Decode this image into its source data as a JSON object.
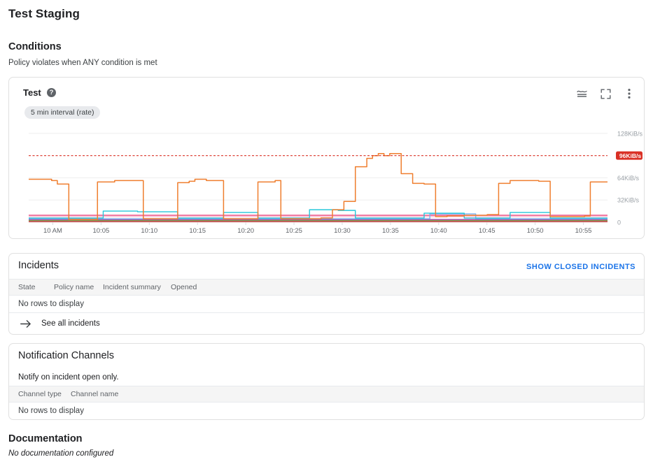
{
  "page": {
    "title": "Test Staging"
  },
  "conditions": {
    "heading": "Conditions",
    "subtitle": "Policy violates when ANY condition is met",
    "chart_card": {
      "title": "Test",
      "help_icon": "help-icon",
      "help_glyph": "?",
      "interval_chip": "5 min interval (rate)",
      "actions": [
        {
          "name": "chart-legend-icon",
          "label": "Legend"
        },
        {
          "name": "fullscreen-icon",
          "label": "Expand"
        },
        {
          "name": "more-options-icon",
          "label": "More options"
        }
      ]
    }
  },
  "incidents": {
    "heading": "Incidents",
    "show_closed_label": "SHOW CLOSED INCIDENTS",
    "columns": [
      "State",
      "Policy name",
      "Incident summary",
      "Opened"
    ],
    "empty_text": "No rows to display",
    "see_all_label": "See all incidents",
    "see_all_icon": "arrow-right-icon"
  },
  "notification_channels": {
    "heading": "Notification Channels",
    "notify_text": "Notify on incident open only.",
    "columns": [
      "Channel type",
      "Channel name"
    ],
    "empty_text": "No rows to display"
  },
  "documentation": {
    "heading": "Documentation",
    "body": "No documentation configured"
  },
  "colors": {
    "accent_link": "#1a73e8",
    "threshold": "#d93025",
    "primary_series": "#ef7e2e",
    "chip_bg": "#e8eaed",
    "grid": "#eeeeee"
  },
  "chart_data": {
    "type": "line",
    "title": "Test",
    "xlabel": "",
    "ylabel": "",
    "grid": true,
    "legend_position": "none",
    "ylim": [
      0,
      140
    ],
    "y_ticks": [
      0,
      32,
      64,
      128
    ],
    "y_tick_labels": [
      "0",
      "32KiB/s",
      "64KiB/s",
      "128KiB/s"
    ],
    "y_unit": "KiB/s",
    "x_tick_labels": [
      "10 AM",
      "10:05",
      "10:10",
      "10:15",
      "10:20",
      "10:25",
      "10:30",
      "10:35",
      "10:40",
      "10:45",
      "10:50",
      "10:55"
    ],
    "threshold": {
      "value": 96,
      "label": "96KiB/s",
      "style": "dashed",
      "color": "#d93025"
    },
    "series": [
      {
        "name": "series-primary",
        "color": "#ef7e2e",
        "values": [
          62,
          62,
          62,
          62,
          60,
          55,
          55,
          4,
          4,
          4,
          4,
          4,
          58,
          58,
          58,
          60,
          60,
          60,
          60,
          60,
          5,
          5,
          5,
          5,
          5,
          5,
          57,
          57,
          59,
          62,
          62,
          60,
          60,
          60,
          5,
          5,
          5,
          5,
          5,
          5,
          58,
          58,
          58,
          60,
          5,
          5,
          5,
          5,
          5,
          5,
          5,
          6,
          6,
          18,
          18,
          30,
          30,
          80,
          80,
          92,
          96,
          99,
          96,
          99,
          99,
          70,
          70,
          56,
          56,
          55,
          55,
          8,
          8,
          9,
          9,
          9,
          10,
          10,
          10,
          10,
          11,
          11,
          56,
          56,
          60,
          60,
          60,
          60,
          60,
          59,
          59,
          8,
          8,
          8,
          8,
          8,
          8,
          9,
          58,
          58,
          58,
          58
        ]
      },
      {
        "name": "series-cyan",
        "color": "#26c6da",
        "values": [
          6,
          6,
          6,
          6,
          6,
          6,
          6,
          6,
          6,
          6,
          6,
          6,
          6,
          16,
          16,
          16,
          16,
          16,
          16,
          15,
          15,
          15,
          15,
          15,
          15,
          15,
          6,
          6,
          6,
          6,
          6,
          6,
          6,
          6,
          14,
          14,
          14,
          14,
          14,
          14,
          6,
          6,
          6,
          6,
          6,
          6,
          6,
          6,
          6,
          18,
          18,
          18,
          18,
          18,
          17,
          17,
          17,
          6,
          6,
          6,
          6,
          6,
          6,
          6,
          6,
          6,
          6,
          6,
          6,
          13,
          13,
          13,
          13,
          13,
          13,
          13,
          6,
          6,
          6,
          6,
          6,
          6,
          6,
          6,
          14,
          14,
          14,
          14,
          14,
          14,
          14,
          6,
          6,
          6,
          6,
          6,
          6,
          6,
          6,
          6,
          6,
          6
        ]
      },
      {
        "name": "series-lightblue",
        "color": "#77b2ef",
        "values": [
          5,
          5,
          5,
          5,
          5,
          5,
          5,
          5,
          5,
          5,
          5,
          5,
          5,
          5,
          5,
          5,
          5,
          5,
          5,
          5,
          5,
          5,
          5,
          5,
          5,
          5,
          5,
          5,
          5,
          5,
          5,
          5,
          5,
          5,
          5,
          5,
          5,
          5,
          5,
          5,
          5,
          5,
          5,
          5,
          5,
          5,
          5,
          5,
          5,
          5,
          5,
          5,
          5,
          5,
          5,
          5,
          5,
          5,
          5,
          5,
          5,
          5,
          5,
          5,
          5,
          5,
          5,
          5,
          5,
          5,
          12,
          12,
          12,
          12,
          12,
          12,
          12,
          12,
          5,
          5,
          5,
          5,
          5,
          5,
          5,
          5,
          5,
          5,
          5,
          5,
          5,
          5,
          5,
          5,
          5,
          5,
          5,
          5,
          5,
          5,
          5,
          5
        ]
      },
      {
        "name": "series-pink",
        "color": "#ec407a",
        "values": [
          10,
          10,
          10,
          10,
          10,
          10,
          10,
          10,
          10,
          10,
          10,
          10,
          10,
          10,
          10,
          10,
          10,
          10,
          10,
          10,
          10,
          10,
          10,
          10,
          10,
          10,
          10,
          10,
          10,
          10,
          10,
          10,
          10,
          10,
          10,
          10,
          10,
          10,
          10,
          10,
          10,
          10,
          10,
          10,
          10,
          10,
          10,
          10,
          10,
          10,
          10,
          10,
          10,
          10,
          10,
          10,
          10,
          10,
          10,
          10,
          10,
          10,
          10,
          10,
          10,
          10,
          10,
          10,
          10,
          10,
          10,
          10,
          10,
          10,
          10,
          10,
          10,
          10,
          10,
          10,
          10,
          10,
          10,
          10,
          10,
          10,
          10,
          10,
          10,
          10,
          10,
          10,
          10,
          10,
          10,
          10,
          10,
          10,
          10,
          10,
          10,
          10
        ]
      },
      {
        "name": "series-lightpink",
        "color": "#f8bbd0",
        "values": [
          8,
          8,
          8,
          8,
          8,
          8,
          8,
          8,
          8,
          8,
          8,
          8,
          8,
          8,
          8,
          8,
          8,
          8,
          8,
          8,
          8,
          8,
          8,
          8,
          8,
          8,
          8,
          8,
          8,
          8,
          8,
          8,
          8,
          8,
          8,
          8,
          8,
          8,
          8,
          8,
          8,
          8,
          8,
          8,
          8,
          8,
          8,
          8,
          8,
          8,
          8,
          8,
          8,
          8,
          8,
          8,
          8,
          8,
          8,
          8,
          8,
          8,
          8,
          8,
          8,
          8,
          8,
          8,
          8,
          8,
          8,
          8,
          8,
          8,
          8,
          8,
          8,
          8,
          8,
          8,
          8,
          8,
          8,
          8,
          8,
          8,
          8,
          8,
          8,
          8,
          8,
          8,
          8,
          8,
          8,
          8,
          8,
          8,
          8,
          8,
          8,
          8
        ]
      },
      {
        "name": "series-purple",
        "color": "#ab47bc",
        "values": [
          4,
          4,
          4,
          4,
          4,
          4,
          4,
          4,
          4,
          4,
          4,
          4,
          4,
          4,
          4,
          4,
          4,
          4,
          4,
          4,
          4,
          4,
          4,
          4,
          4,
          4,
          4,
          4,
          4,
          4,
          4,
          4,
          4,
          4,
          4,
          4,
          4,
          4,
          4,
          4,
          4,
          4,
          4,
          4,
          4,
          4,
          4,
          4,
          4,
          4,
          4,
          4,
          4,
          4,
          4,
          4,
          4,
          4,
          4,
          4,
          4,
          4,
          4,
          4,
          4,
          4,
          4,
          4,
          4,
          4,
          4,
          4,
          4,
          4,
          4,
          4,
          4,
          4,
          4,
          4,
          4,
          4,
          4,
          4,
          4,
          4,
          4,
          4,
          4,
          4,
          4,
          4,
          4,
          4,
          4,
          4,
          4,
          4,
          4,
          4,
          4,
          4
        ]
      },
      {
        "name": "series-green",
        "color": "#7cb342",
        "values": [
          3,
          3,
          3,
          3,
          3,
          3,
          3,
          3,
          3,
          3,
          3,
          3,
          3,
          3,
          3,
          3,
          3,
          3,
          3,
          3,
          3,
          3,
          3,
          3,
          3,
          3,
          3,
          3,
          3,
          3,
          3,
          3,
          3,
          3,
          3,
          3,
          3,
          3,
          3,
          3,
          3,
          3,
          3,
          3,
          3,
          3,
          3,
          3,
          3,
          3,
          3,
          3,
          3,
          3,
          3,
          3,
          3,
          3,
          3,
          3,
          3,
          3,
          3,
          3,
          3,
          3,
          3,
          3,
          3,
          3,
          3,
          3,
          3,
          3,
          3,
          3,
          3,
          3,
          3,
          3,
          3,
          3,
          3,
          3,
          3,
          3,
          3,
          3,
          3,
          3,
          3,
          3,
          3,
          3,
          3,
          3,
          3,
          3,
          3,
          3,
          3,
          3
        ]
      },
      {
        "name": "series-brown",
        "color": "#8d6e63",
        "values": [
          2,
          2,
          2,
          2,
          2,
          2,
          2,
          2,
          2,
          2,
          2,
          2,
          2,
          2,
          2,
          2,
          2,
          2,
          2,
          2,
          2,
          2,
          2,
          2,
          2,
          2,
          2,
          2,
          2,
          2,
          2,
          2,
          2,
          2,
          2,
          2,
          2,
          2,
          2,
          2,
          2,
          2,
          2,
          2,
          2,
          2,
          2,
          2,
          2,
          2,
          2,
          2,
          2,
          2,
          2,
          2,
          2,
          2,
          2,
          2,
          2,
          2,
          2,
          2,
          2,
          2,
          2,
          2,
          2,
          2,
          2,
          2,
          2,
          2,
          2,
          2,
          2,
          2,
          2,
          2,
          2,
          2,
          2,
          2,
          2,
          2,
          2,
          2,
          2,
          2,
          2,
          2,
          2,
          2,
          2,
          2,
          2,
          2,
          2,
          2,
          2,
          2
        ]
      },
      {
        "name": "series-crimson",
        "color": "#e53935",
        "values": [
          1,
          1,
          1,
          1,
          1,
          1,
          1,
          1,
          1,
          1,
          1,
          1,
          1,
          1,
          1,
          1,
          1,
          1,
          1,
          1,
          1,
          1,
          1,
          1,
          1,
          1,
          1,
          1,
          1,
          1,
          1,
          1,
          1,
          1,
          1,
          1,
          1,
          1,
          1,
          1,
          1,
          1,
          1,
          1,
          1,
          1,
          1,
          1,
          1,
          1,
          1,
          1,
          1,
          1,
          1,
          1,
          1,
          1,
          1,
          1,
          1,
          1,
          1,
          1,
          1,
          1,
          1,
          1,
          1,
          1,
          1,
          1,
          1,
          1,
          1,
          1,
          1,
          1,
          1,
          1,
          1,
          1,
          1,
          1,
          1,
          1,
          1,
          1,
          1,
          1,
          1,
          1,
          1,
          1,
          1,
          1,
          1,
          1,
          1,
          1,
          1,
          1
        ]
      }
    ]
  }
}
